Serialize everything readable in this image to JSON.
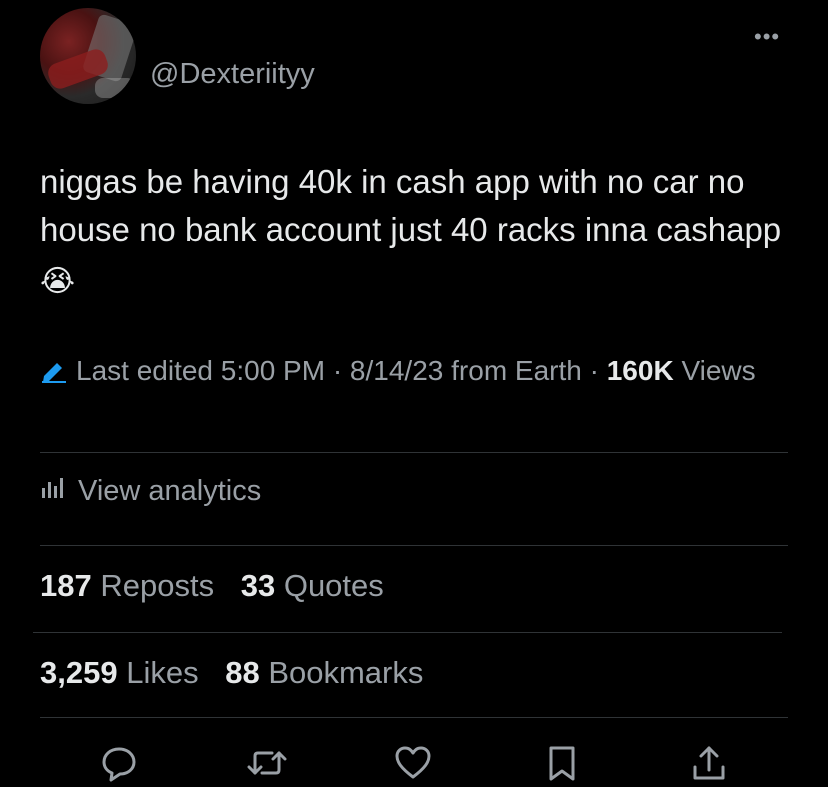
{
  "author": {
    "handle": "@Dexteriityy"
  },
  "more_icon": "more-horizontal-icon",
  "tweet": {
    "text": "niggas be having 40k in cash app with no car no house no bank account just 40 racks inna cashapp",
    "emoji": "😭"
  },
  "meta": {
    "edited_label": "Last edited 5:00 PM · 8/14/23",
    "location": "from Earth",
    "separator": "·",
    "views_count": "160K",
    "views_label": "Views"
  },
  "analytics": {
    "label": "View analytics"
  },
  "stats": {
    "reposts_count": "187",
    "reposts_label": "Reposts",
    "quotes_count": "33",
    "quotes_label": "Quotes",
    "likes_count": "3,259",
    "likes_label": "Likes",
    "bookmarks_count": "88",
    "bookmarks_label": "Bookmarks"
  },
  "colors": {
    "background": "#000000",
    "text_primary": "#e7e9ea",
    "text_secondary": "#9aa0a6",
    "accent": "#1d9bf0",
    "divider": "#2f3336"
  },
  "actions": [
    "reply-icon",
    "repost-icon",
    "like-icon",
    "bookmark-icon",
    "share-icon"
  ]
}
